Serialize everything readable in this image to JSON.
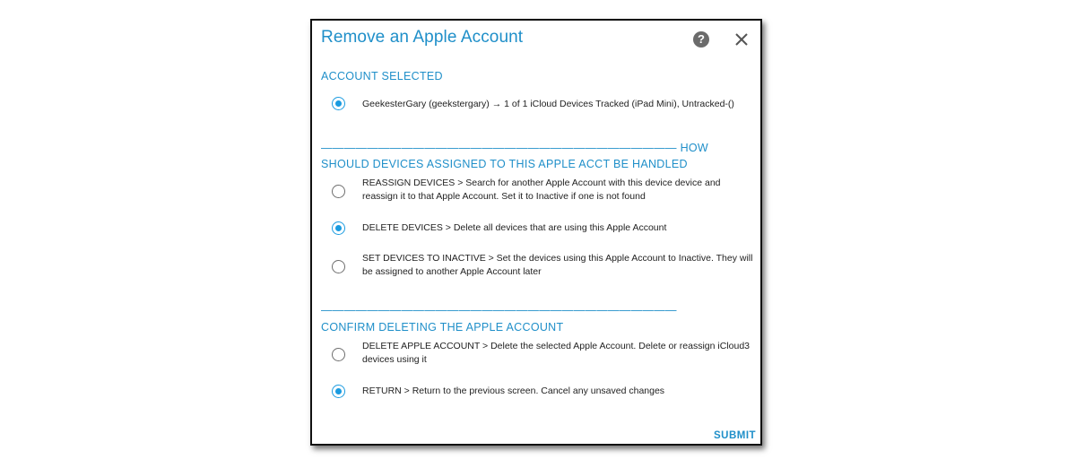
{
  "dialog": {
    "title": "Remove an Apple Account",
    "submit_label": "SUBMIT"
  },
  "icons": {
    "help": "help-circle-icon",
    "close": "close-icon"
  },
  "colors": {
    "accent": "#1f8fc9",
    "radio_selected": "#1a9be0"
  },
  "account_section": {
    "label": "ACCOUNT SELECTED",
    "options": [
      {
        "text": "GeekesterGary (geekstergary) → 1 of 1 iCloud Devices Tracked (iPad Mini), Untracked-()",
        "selected": true
      }
    ]
  },
  "devices_section": {
    "label_line1": "——————————————————————————————— HOW",
    "label_line2": "SHOULD DEVICES ASSIGNED TO THIS APPLE ACCT BE HANDLED",
    "options": [
      {
        "text": "REASSIGN DEVICES > Search for another Apple Account with this device device and reassign it to that Apple Account. Set it to Inactive if one is not found",
        "selected": false
      },
      {
        "text": "DELETE DEVICES > Delete all devices that are using this Apple Account",
        "selected": true
      },
      {
        "text": "SET DEVICES TO INACTIVE > Set the devices using this Apple Account to Inactive. They will be assigned to another Apple Account later",
        "selected": false
      }
    ]
  },
  "confirm_section": {
    "separator": "———————————————————————————————",
    "label": "CONFIRM DELETING THE APPLE ACCOUNT",
    "options": [
      {
        "text": "DELETE APPLE ACCOUNT > Delete the selected Apple Account. Delete or reassign iCloud3 devices using it",
        "selected": false
      },
      {
        "text": "RETURN > Return to the previous screen. Cancel any unsaved changes",
        "selected": true
      }
    ]
  }
}
